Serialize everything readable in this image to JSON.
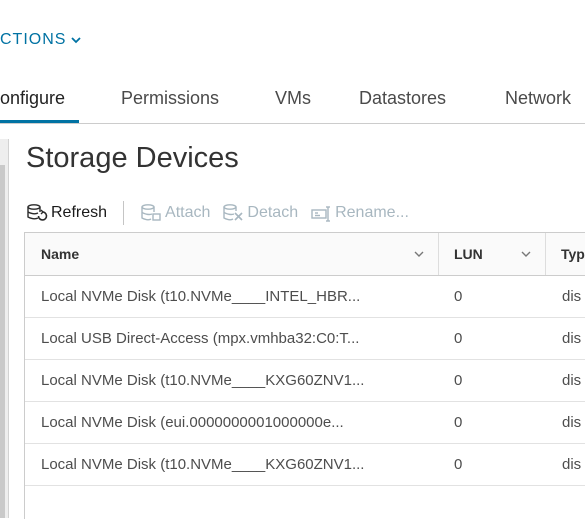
{
  "actions": {
    "label": "CTIONS",
    "icon": "chevron-down-icon"
  },
  "tabs": [
    {
      "label": "onfigure",
      "active": true
    },
    {
      "label": "Permissions",
      "active": false
    },
    {
      "label": "VMs",
      "active": false
    },
    {
      "label": "Datastores",
      "active": false
    },
    {
      "label": "Network",
      "active": false
    }
  ],
  "page": {
    "title": "Storage Devices"
  },
  "toolbar": {
    "refresh": {
      "label": "Refresh",
      "icon": "refresh-storage-icon",
      "enabled": true
    },
    "attach": {
      "label": "Attach",
      "icon": "attach-storage-icon",
      "enabled": false
    },
    "detach": {
      "label": "Detach",
      "icon": "detach-storage-icon",
      "enabled": false
    },
    "rename": {
      "label": "Rename...",
      "icon": "rename-icon",
      "enabled": false
    }
  },
  "grid": {
    "columns": [
      "Name",
      "LUN",
      "Typ"
    ],
    "rows": [
      {
        "name": "Local NVMe Disk (t10.NVMe____INTEL_HBR...",
        "lun": "0",
        "type": "dis"
      },
      {
        "name": "Local USB Direct-Access (mpx.vmhba32:C0:T...",
        "lun": "0",
        "type": "dis"
      },
      {
        "name": "Local NVMe Disk (t10.NVMe____KXG60ZNV1...",
        "lun": "0",
        "type": "dis"
      },
      {
        "name": "Local NVMe Disk (eui.0000000001000000e...",
        "lun": "0",
        "type": "dis"
      },
      {
        "name": "Local NVMe Disk (t10.NVMe____KXG60ZNV1...",
        "lun": "0",
        "type": "dis"
      }
    ]
  },
  "colors": {
    "accent": "#0072a3",
    "border": "#cccccc",
    "disabled": "#a8b7c0"
  }
}
